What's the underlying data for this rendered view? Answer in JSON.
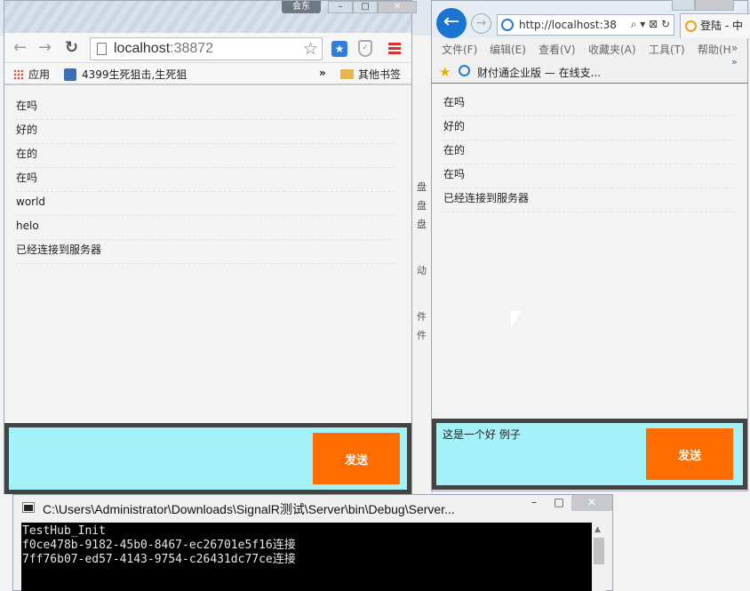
{
  "background": {
    "fragments": [
      "盘",
      "盘",
      "盘",
      "动",
      "件",
      "件"
    ]
  },
  "chrome": {
    "top_tab": "会东",
    "window_buttons": [
      "–",
      "□",
      "✕"
    ],
    "url_host": "localhost",
    "url_port": ":38872",
    "bookmarks": {
      "apps": "应用",
      "item1": "4399生死狙击,生死狙",
      "more": "»",
      "other": "其他书签"
    },
    "messages": [
      "在吗",
      "好的",
      "在的",
      "在吗",
      "world",
      "helo",
      "已经连接到服务器"
    ],
    "send_label": "发送",
    "input_value": ""
  },
  "ie": {
    "url": "http://localhost:38",
    "addr_tools": "⌕ ▾ ⊠ ↻",
    "tab_title": "登陆 - 中",
    "menu": [
      "文件(F)",
      "编辑(E)",
      "查看(V)",
      "收藏夹(A)",
      "工具(T)",
      "帮助(H"
    ],
    "fav_item": "财付通企业版 — 在线支...",
    "messages": [
      "在吗",
      "好的",
      "在的",
      "在吗",
      "已经连接到服务器"
    ],
    "input_value": "这是一个好 例子",
    "send_label": "发送"
  },
  "console": {
    "title": "C:\\Users\\Administrator\\Downloads\\SignalR测试\\Server\\bin\\Debug\\Server...",
    "buttons": [
      "–",
      "□",
      "✕"
    ],
    "lines": [
      "TestHub_Init",
      "f0ce478b-9182-45b0-8467-ec26701e5f16连接",
      "7ff76b07-ed57-4143-9754-c26431dc77ce连接"
    ]
  },
  "colors": {
    "composer_bg": "#a4f2f8",
    "send_button": "#ff6c00",
    "composer_border": "#444444"
  }
}
